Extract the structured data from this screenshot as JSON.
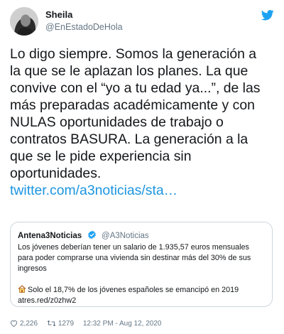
{
  "tweet": {
    "author_name": "Sheila",
    "author_handle": "@EnEstadoDeHola",
    "body_lines": [
      "Lo digo siempre. Somos la generación a",
      "la que se le aplazan los planes. La que",
      "convive con el “yo a tu edad ya...”, de las",
      "más preparadas académicamente y con",
      "NULAS oportunidades de trabajo o",
      "contratos BASURA. La generación a la",
      "que se le pide experiencia sin",
      "oportunidades."
    ],
    "link_text": "twitter.com/a3noticias/sta…",
    "link_color": "#1b95e0"
  },
  "quoted": {
    "author_name": "Antena3Noticias",
    "author_handle": "@A3Noticias",
    "text_lines": [
      "Los jóvenes deberían tener un salario de 1.935,57 euros mensuales",
      "para poder comprarse una vivienda sin destinar más del 30% de sus",
      "ingresos"
    ],
    "stat_line": "Solo el 18,7% de los jóvenes españoles se emancipó en 2019",
    "short_link": "atres.red/z0zhw2",
    "stat_icon": "house-icon"
  },
  "footer": {
    "likes": "2,226",
    "retweets": "1279",
    "timestamp": "12:32 PM - Aug 12, 2020"
  },
  "colors": {
    "twitter_blue": "#1da1f2",
    "text": "#14171a",
    "secondary": "#657786"
  }
}
